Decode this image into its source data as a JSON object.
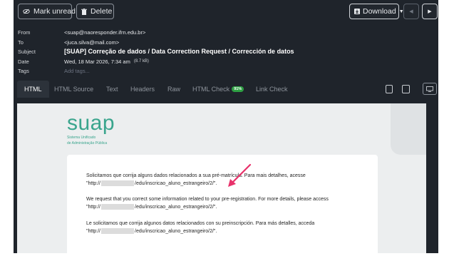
{
  "toolbar": {
    "mark_unread": "Mark unread",
    "delete": "Delete",
    "download": "Download",
    "icons": [
      "eye-off-icon",
      "trash-icon",
      "download-icon",
      "chevron-left-icon",
      "chevron-right-icon"
    ]
  },
  "header": {
    "from_label": "From",
    "from_value": "<suap@naoresponder.ifrn.edu.br>",
    "to_label": "To",
    "to_value": "<juca.silva@mail.com>",
    "subject_label": "Subject",
    "subject_value": "[SUAP] Correção de dados / Data Correction Request / Corrección de datos",
    "date_label": "Date",
    "date_value": "Wed, 18 Mar 2026, 7:34 am",
    "size_value": "(8.7 kB)",
    "tags_label": "Tags",
    "tags_placeholder": "Add tags..."
  },
  "tabs": {
    "html": "HTML",
    "html_source": "HTML Source",
    "text": "Text",
    "headers": "Headers",
    "raw": "Raw",
    "html_check": "HTML Check",
    "html_check_badge": "91%",
    "link_check": "Link Check"
  },
  "email": {
    "logo_text": "suap",
    "logo_sub1": "Sistema Unificado",
    "logo_sub2": "de Administração Pública",
    "pt_line1": "Solicitamos que corrija alguns dados relacionados a sua pré-matrícula. Para mais detalhes, acesse",
    "pt_link_start": "\"http://",
    "pt_link_end": "/edu/inscricao_aluno_estrangeiro/2/\".",
    "en_line1": "We request that you correct some information related to your pre-registration. For more details, please access",
    "en_link_start": "\"http://",
    "en_link_end": "/edu/inscricao_aluno_estrangeiro/2/\".",
    "es_line1": "Le solicitamos que corrija algunos datos relacionados con su preinscripción. Para más detalles, acceda",
    "es_link_start": "\"http://",
    "es_link_end": "/edu/inscricao_aluno_estrangeiro/2/\"."
  },
  "colors": {
    "app_bg": "#1f242b",
    "accent_green": "#3aa58d",
    "badge_green": "#2ea043",
    "arrow": "#e8326b"
  }
}
